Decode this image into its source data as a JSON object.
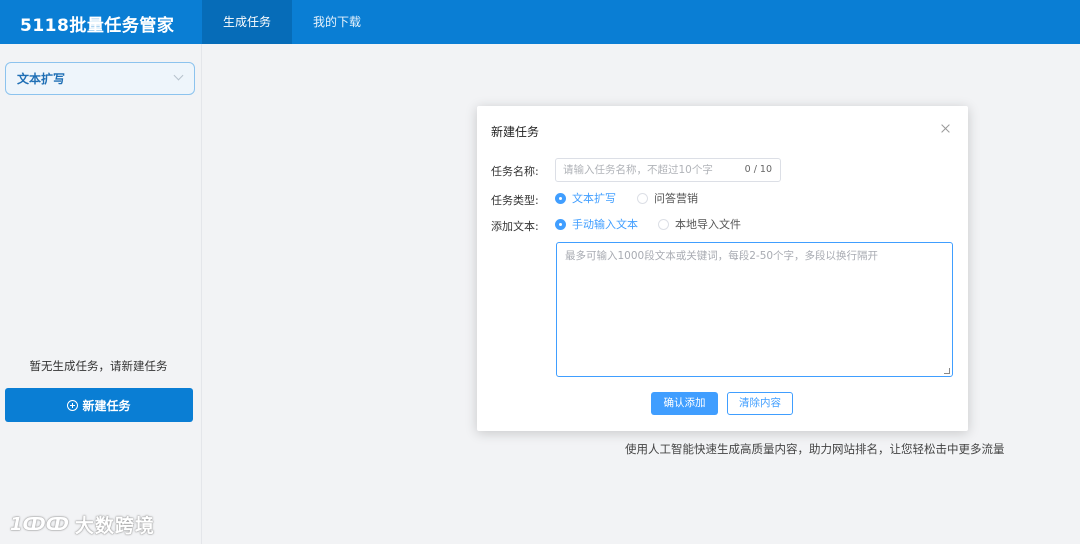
{
  "app": {
    "title": "5118批量任务管家"
  },
  "nav": {
    "tabs": [
      {
        "label": "生成任务",
        "active": true
      },
      {
        "label": "我的下载",
        "active": false
      }
    ]
  },
  "sidebar": {
    "select": {
      "value": "文本扩写"
    },
    "empty_text": "暂无生成任务，请新建任务",
    "new_task_label": "新建任务"
  },
  "main": {
    "tagline": "使用人工智能快速生成高质量内容，助力网站排名，让您轻松击中更多流量"
  },
  "watermark": {
    "logo_text": "1ↀↀ",
    "text": "大数跨境"
  },
  "modal": {
    "title": "新建任务",
    "task_name": {
      "label": "任务名称:",
      "placeholder": "请输入任务名称，不超过10个字",
      "value": "",
      "counter": "0 / 10"
    },
    "task_type": {
      "label": "任务类型:",
      "options": [
        {
          "label": "文本扩写",
          "checked": true
        },
        {
          "label": "问答营销",
          "checked": false
        }
      ]
    },
    "add_text": {
      "label": "添加文本:",
      "options": [
        {
          "label": "手动输入文本",
          "checked": true
        },
        {
          "label": "本地导入文件",
          "checked": false
        }
      ]
    },
    "textarea": {
      "placeholder": "最多可输入1000段文本或关键词，每段2-50个字，多段以换行隔开",
      "value": ""
    },
    "confirm_label": "确认添加",
    "clear_label": "清除内容"
  },
  "colors": {
    "topbar": "#0a7ed4",
    "primary": "#409eff",
    "background": "#f2f3f5"
  }
}
